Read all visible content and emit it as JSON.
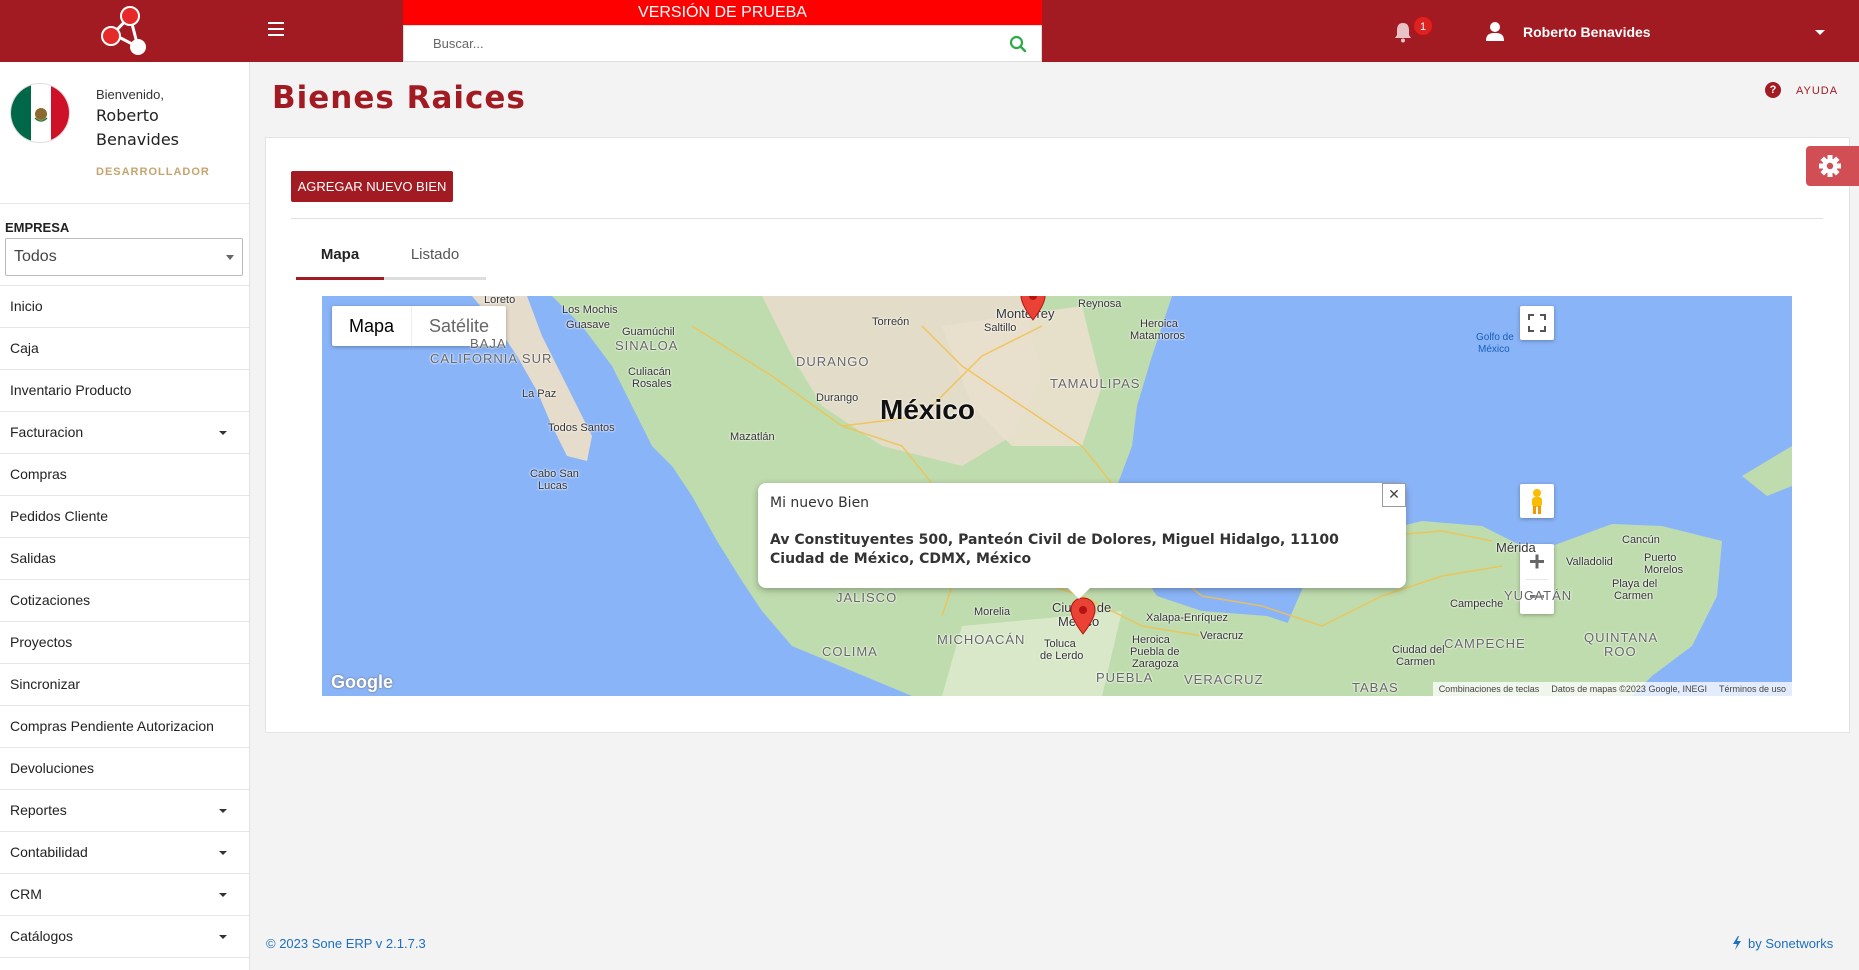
{
  "header": {
    "trial_banner": "VERSIÓN DE PRUEBA",
    "search_placeholder": "Buscar...",
    "notification_count": "1",
    "user_name": "Roberto Benavides"
  },
  "sidebar": {
    "welcome": "Bienvenido,",
    "first_name": "Roberto",
    "last_name": "Benavides",
    "role": "DESARROLLADOR",
    "empresa_label": "EMPRESA",
    "empresa_value": "Todos",
    "items": [
      {
        "label": "Inicio",
        "dropdown": false
      },
      {
        "label": "Caja",
        "dropdown": false
      },
      {
        "label": "Inventario Producto",
        "dropdown": false
      },
      {
        "label": "Facturacion",
        "dropdown": true
      },
      {
        "label": "Compras",
        "dropdown": false
      },
      {
        "label": "Pedidos Cliente",
        "dropdown": false
      },
      {
        "label": "Salidas",
        "dropdown": false
      },
      {
        "label": "Cotizaciones",
        "dropdown": false
      },
      {
        "label": "Proyectos",
        "dropdown": false
      },
      {
        "label": "Sincronizar",
        "dropdown": false
      },
      {
        "label": "Compras Pendiente Autorizacion",
        "dropdown": false
      },
      {
        "label": "Devoluciones",
        "dropdown": false
      },
      {
        "label": "Reportes",
        "dropdown": true
      },
      {
        "label": "Contabilidad",
        "dropdown": true
      },
      {
        "label": "CRM",
        "dropdown": true
      },
      {
        "label": "Catálogos",
        "dropdown": true
      }
    ]
  },
  "main": {
    "title": "Bienes Raices",
    "help_label": "AYUDA",
    "add_button": "AGREGAR NUEVO BIEN",
    "tabs": [
      {
        "label": "Mapa",
        "active": true
      },
      {
        "label": "Listado",
        "active": false
      }
    ]
  },
  "map": {
    "type_map": "Mapa",
    "type_satellite": "Satélite",
    "country_label": "México",
    "infowindow_title": "Mi nuevo Bien",
    "infowindow_address": "Av Constituyentes 500, Panteón Civil de Dolores, Miguel Hidalgo, 11100 Ciudad de México, CDMX, México",
    "google_logo": "Google",
    "attribution": [
      "Combinaciones de teclas",
      "Datos de mapas ©2023 Google, INEGI",
      "Términos de uso"
    ],
    "labels": {
      "loreto": "Loreto",
      "losmochis": "Los Mochis",
      "guasave": "Guasave",
      "guamuchil": "Guamúchil",
      "bajacal": "BAJA",
      "bajacal2": "CALIFORNIA SUR",
      "sinaloa": "SINALOA",
      "lapaz": "La Paz",
      "culiacan": "Culiacán",
      "culiacan2": "Rosales",
      "todossantos": "Todos Santos",
      "cabo": "Cabo San",
      "cabo2": "Lucas",
      "mazatlan": "Mazatlán",
      "durango_st": "DURANGO",
      "durango": "Durango",
      "torreon": "Torreón",
      "saltillo": "Saltillo",
      "monterrey": "Monterrey",
      "reynosa": "Reynosa",
      "heroica": "Heroica",
      "matamoros": "Matamoros",
      "tamaulipas": "TAMAULIPAS",
      "golfo": "Golfo de",
      "golfo2": "México",
      "jalisco": "JALISCO",
      "colima": "COLIMA",
      "michoacan": "MICHOACÁN",
      "morelia": "Morelia",
      "cdmx": "Ciudad de",
      "cdmx2": "México",
      "toluca": "Toluca",
      "toluca2": "de Lerdo",
      "xalapa": "Xalapa-Enríquez",
      "veracruz_c": "Veracruz",
      "puebla_c": "Heroica",
      "puebla_c2": "Puebla de",
      "puebla_c3": "Zaragoza",
      "puebla": "PUEBLA",
      "veracruz": "VERACRUZ",
      "tabasco": "TABAS",
      "merida": "Mérida",
      "valladolid": "Valladolid",
      "cancun": "Cancún",
      "puertomorelos": "Puerto",
      "puertomorelos2": "Morelos",
      "playa": "Playa del",
      "playa2": "Carmen",
      "yucatan": "YUCATÁN",
      "campeche_c": "Campeche",
      "campeche": "CAMPECHE",
      "cdcarmen": "Ciudad del",
      "cdcarmen2": "Carmen",
      "quintana": "QUINTANA",
      "quintana2": "ROO"
    }
  },
  "footer": {
    "left": "© 2023 Sone ERP v 2.1.7.3",
    "right": "by Sonetworks"
  },
  "colors": {
    "brand": "#a31b22",
    "trial": "#ff0000",
    "link": "#1e6fbf",
    "water": "#8ab4f8"
  }
}
